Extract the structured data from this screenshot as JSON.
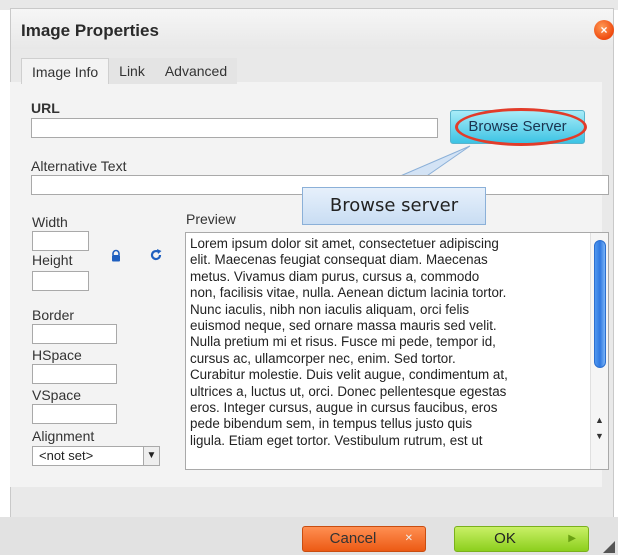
{
  "dialog": {
    "title": "Image Properties",
    "close_label": "×"
  },
  "tabs": [
    {
      "label": "Image Info",
      "active": true
    },
    {
      "label": "Link",
      "active": false
    },
    {
      "label": "Advanced",
      "active": false
    }
  ],
  "image_info": {
    "url_label": "URL",
    "url_value": "",
    "browse_button_label": "Browse Server",
    "callout_text": "Browse server",
    "alt_text_label": "Alternative Text",
    "alt_text_value": "",
    "width_label": "Width",
    "width_value": "",
    "height_label": "Height",
    "height_value": "",
    "border_label": "Border",
    "border_value": "",
    "hspace_label": "HSpace",
    "hspace_value": "",
    "vspace_label": "VSpace",
    "vspace_value": "",
    "alignment_label": "Alignment",
    "alignment_value": "<not set>",
    "preview_label": "Preview",
    "preview_lines": [
      "Lorem ipsum dolor sit amet, consectetuer adipiscing",
      "elit. Maecenas feugiat consequat diam. Maecenas",
      "metus. Vivamus diam purus, cursus a, commodo",
      "non, facilisis vitae, nulla. Aenean dictum lacinia tortor.",
      "Nunc iaculis, nibh non iaculis aliquam, orci felis",
      "euismod neque, sed ornare massa mauris sed velit.",
      "Nulla pretium mi et risus. Fusce mi pede, tempor id,",
      "cursus ac, ullamcorper nec, enim. Sed tortor.",
      "Curabitur molestie. Duis velit augue, condimentum at,",
      "ultrices a, luctus ut, orci. Donec pellentesque egestas",
      "eros. Integer cursus, augue in cursus faucibus, eros",
      "pede bibendum sem, in tempus tellus justo quis",
      "ligula. Etiam eget tortor. Vestibulum rutrum, est ut"
    ]
  },
  "footer": {
    "cancel_label": "Cancel",
    "ok_label": "OK"
  },
  "colors": {
    "accent_browse": "#3cc3e4",
    "highlight": "#e23c2a",
    "cancel": "#ec5a14",
    "ok": "#8ccf1d",
    "close": "#ef4a0f"
  },
  "icons": {
    "lock": "lock-icon",
    "reset": "reset-size-icon",
    "close": "close-icon"
  }
}
